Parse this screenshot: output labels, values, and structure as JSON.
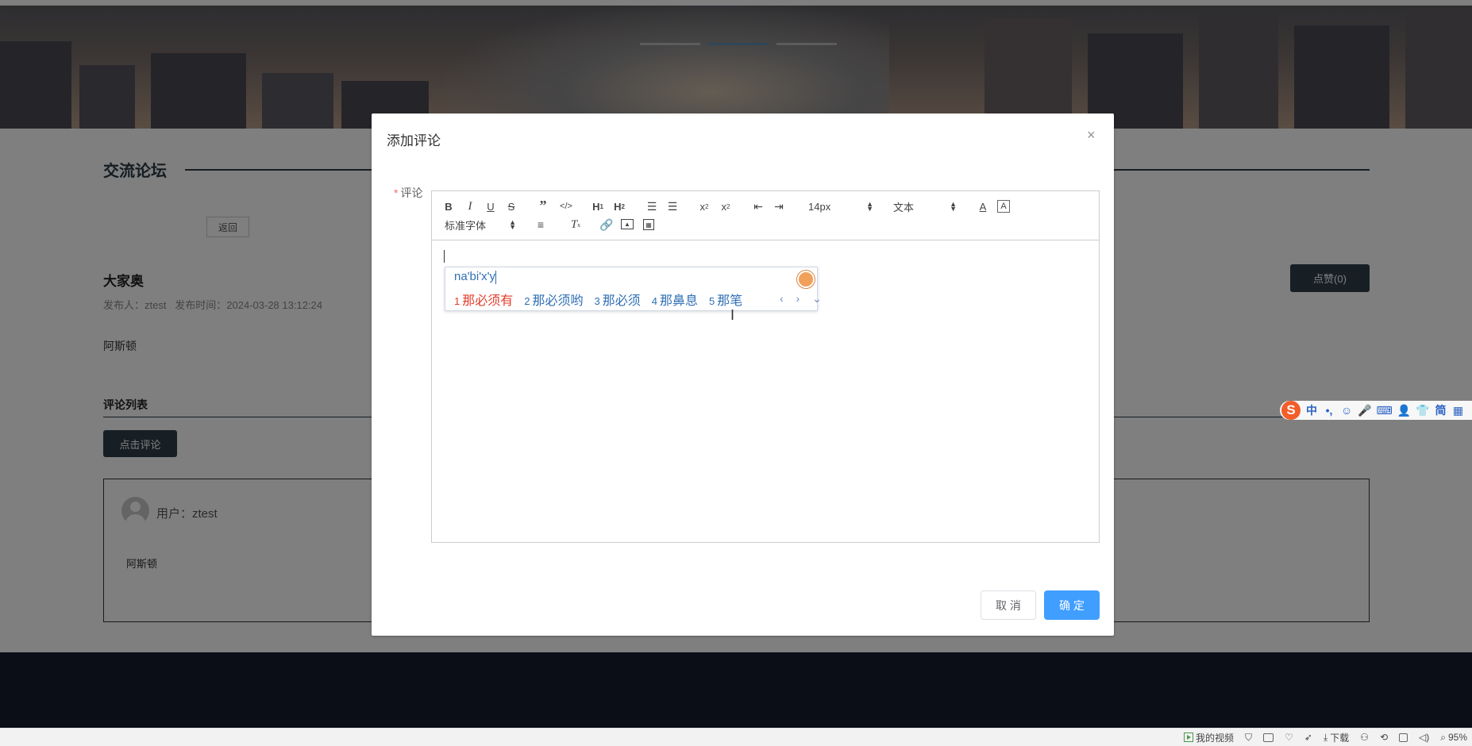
{
  "banner": {
    "slides": 3,
    "active_slide": 2
  },
  "forum": {
    "title": "交流论坛",
    "back_label": "返回"
  },
  "post": {
    "title": "大家奥",
    "meta": "发布人：ztest   发布时间：2024-03-28 13:12:24",
    "body": "阿斯顿",
    "like_label": "点赞(0)"
  },
  "comments": {
    "section_title": "评论列表",
    "add_label": "点击评论",
    "items": [
      {
        "user": "用户：ztest",
        "body": "阿斯顿"
      }
    ]
  },
  "dialog": {
    "title": "添加评论",
    "close_icon": "×",
    "field_label": "评论",
    "required_mark": "*",
    "toolbar": {
      "size_value": "14px",
      "header_value": "文本",
      "font_value": "标准字体"
    },
    "cancel_label": "取 消",
    "ok_label": "确 定"
  },
  "ime": {
    "input": "na'bi'x'y",
    "candidates": [
      {
        "num": "1",
        "text": "那必须有",
        "selected": true
      },
      {
        "num": "2",
        "text": "那必须哟"
      },
      {
        "num": "3",
        "text": "那必须"
      },
      {
        "num": "4",
        "text": "那鼻息"
      },
      {
        "num": "5",
        "text": "那笔"
      }
    ],
    "nav": "‹ › ⌄"
  },
  "sogou_bar": {
    "items": [
      "中",
      "•,",
      "☺",
      "🎤",
      "⌨",
      "👤",
      "👕",
      "简",
      "▦"
    ]
  },
  "statusbar": {
    "video_label": "我的视频",
    "download_label": "下载",
    "zoom": "95%"
  },
  "colors": {
    "primary": "#409eff",
    "dark_button": "#2e3e4a",
    "footer": "#161b2e",
    "required": "#f56c6c"
  }
}
